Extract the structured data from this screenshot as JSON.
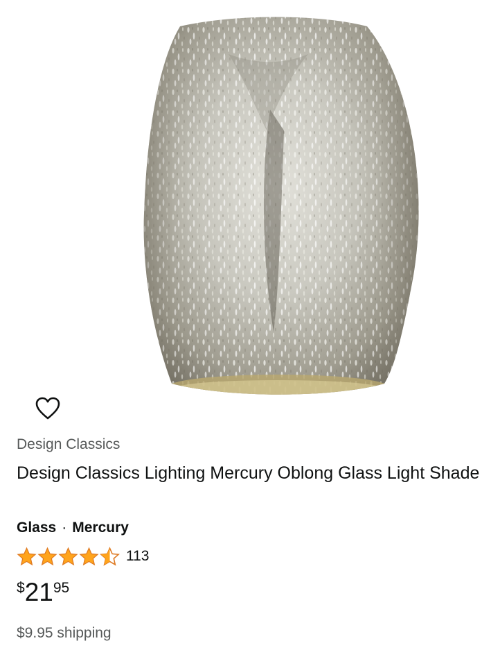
{
  "product": {
    "image_alt": "Mercury oblong glass light shade",
    "wishlist_icon": "heart-outline-icon",
    "brand": "Design Classics",
    "title": "Design Classics Lighting Mercury Oblong Glass Light Shade",
    "variants": {
      "material": "Glass",
      "separator": "·",
      "finish": "Mercury"
    },
    "rating": {
      "stars": 4.5,
      "max_stars": 5,
      "count": "113",
      "star_color": "#ffa41c"
    },
    "price": {
      "symbol": "$",
      "whole": "21",
      "fraction": "95"
    },
    "shipping": "$9.95 shipping"
  }
}
